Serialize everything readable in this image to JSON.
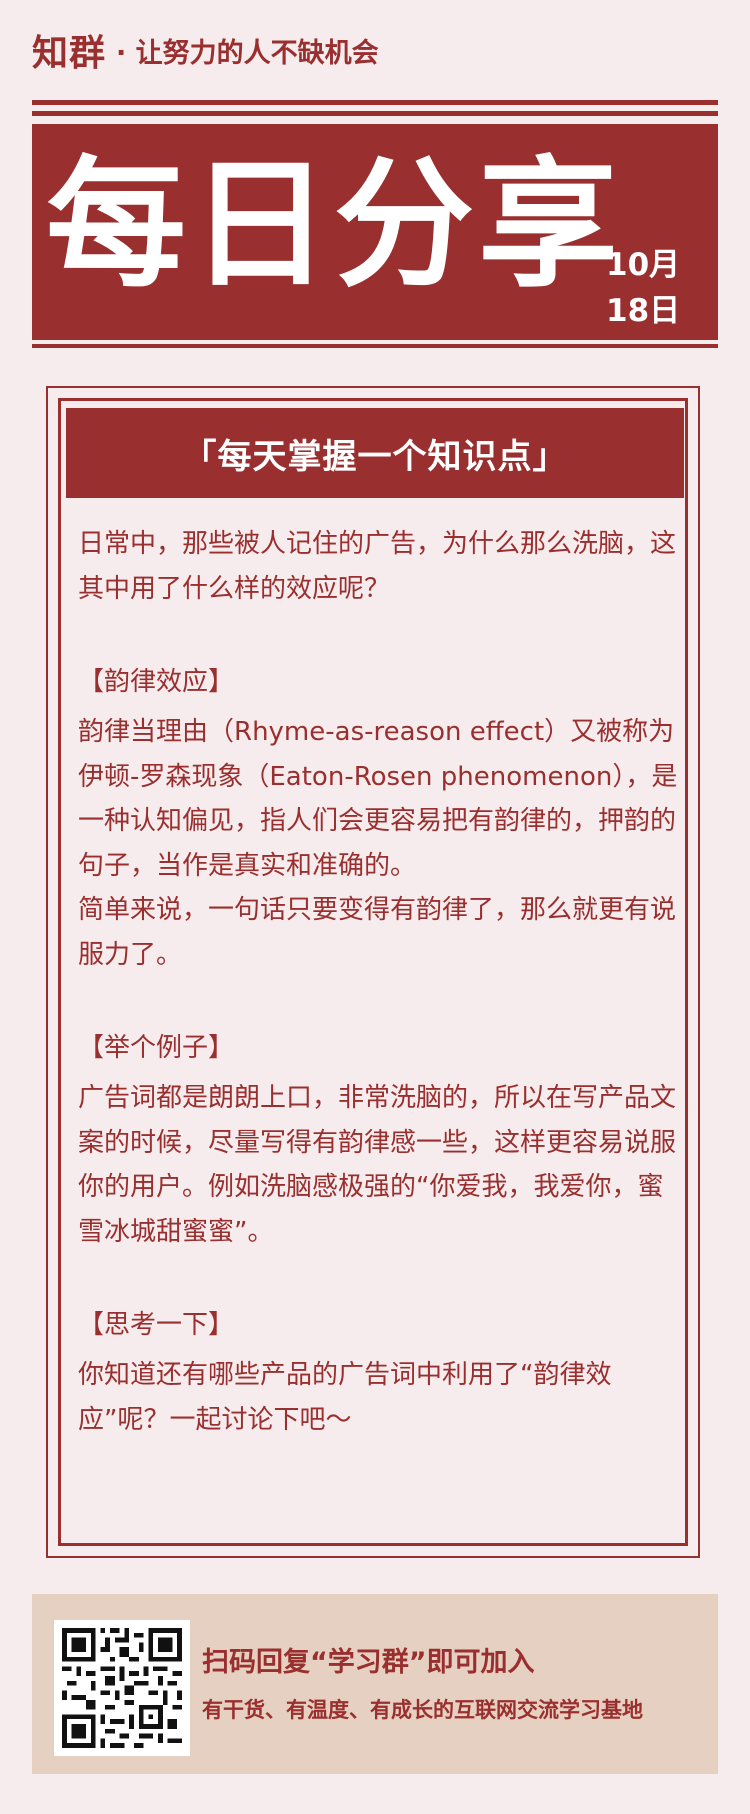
{
  "header": {
    "brand": "知群",
    "slogan": "· 让努力的人不缺机会"
  },
  "banner": {
    "title": "每日分享",
    "date_month": "10月",
    "date_day": "18日"
  },
  "topic": {
    "title": "「每天掌握一个知识点」"
  },
  "content": {
    "intro": "日常中，那些被人记住的广告，为什么那么洗脑，这其中用了什么样的效应呢？",
    "section1_heading": "【韵律效应】",
    "section1_para1": "韵律当理由（Rhyme-as-reason effect）又被称为伊顿-罗森现象（Eaton-Rosen phenomenon），是一种认知偏见，指人们会更容易把有韵律的，押韵的句子，当作是真实和准确的。",
    "section1_para2": "简单来说，一句话只要变得有韵律了，那么就更有说服力了。",
    "section2_heading": "【举个例子】",
    "section2_para": "广告词都是朗朗上口，非常洗脑的，所以在写产品文案的时候，尽量写得有韵律感一些，这样更容易说服你的用户。例如洗脑感极强的“你爱我，我爱你，蜜雪冰城甜蜜蜜”。",
    "section3_heading": "【思考一下】",
    "section3_para": "你知道还有哪些产品的广告词中利用了“韵律效应”呢？一起讨论下吧～"
  },
  "footer": {
    "line1": "扫码回复“学习群”即可加入",
    "line2": "有干货、有温度、有成长的互联网交流学习基地"
  },
  "colors": {
    "primary": "#9a2f2f",
    "background": "#f6eced",
    "footer_bg": "#e6d0c1"
  }
}
